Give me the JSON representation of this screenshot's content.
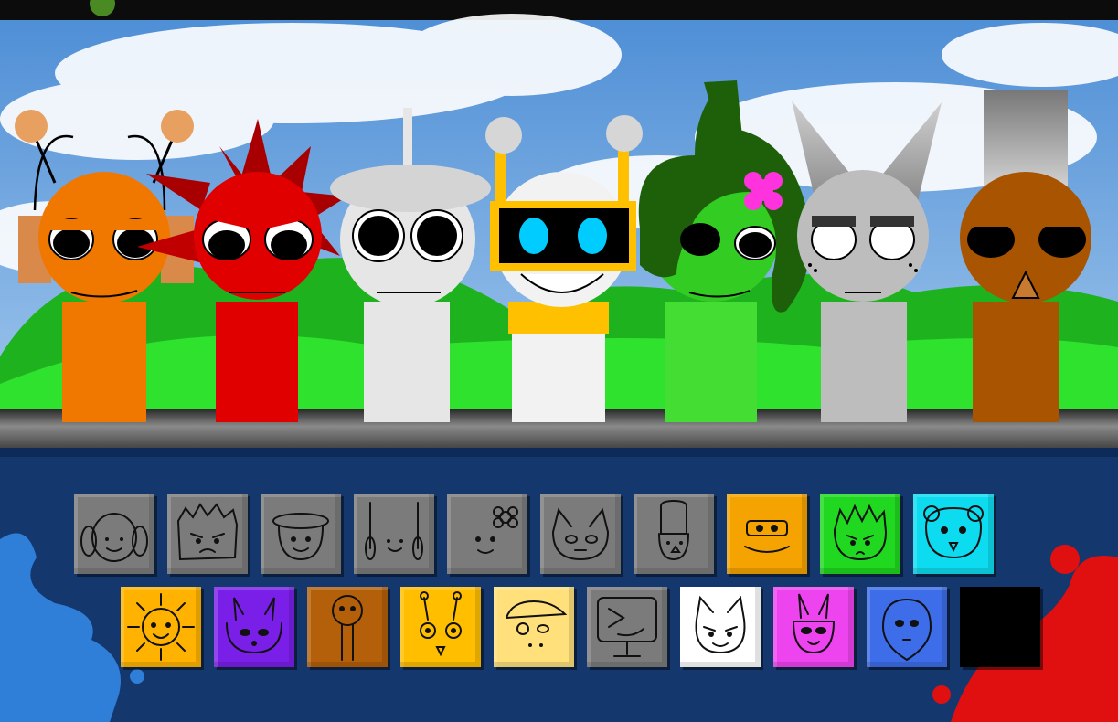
{
  "game": {
    "colors": {
      "sky": "#6fa5dc",
      "hills": "#22c422",
      "panel": "#14376d",
      "rail": "#5a5a5a"
    },
    "stage_characters": [
      {
        "id": "orange-headphones",
        "head": "#f07800",
        "body": "#f07800",
        "accessory": "antenna-headphones"
      },
      {
        "id": "red-spiky",
        "head": "#e00000",
        "body": "#e00000",
        "accessory": "spikes"
      },
      {
        "id": "white-hat",
        "head": "#e6e6e6",
        "body": "#e6e6e6",
        "accessory": "flat-hat"
      },
      {
        "id": "white-robot",
        "head": "#f2f2f2",
        "body": "#f2f2f2",
        "accessory": "visor-antennas"
      },
      {
        "id": "green-hair",
        "head": "#33cc22",
        "body": "#44dd33",
        "accessory": "hair-flower"
      },
      {
        "id": "gray-cat",
        "head": "#bdbdbd",
        "body": "#bdbdbd",
        "accessory": "cat-ears"
      },
      {
        "id": "brown-tophat",
        "head": "#a85400",
        "body": "#a85400",
        "accessory": "top-hat"
      }
    ],
    "palette_row1": [
      {
        "id": "headphones",
        "color": "#7b7b7b",
        "icon": "headphones-face-icon"
      },
      {
        "id": "spiky",
        "color": "#7b7b7b",
        "icon": "spiky-angry-face-icon"
      },
      {
        "id": "flat-hat",
        "color": "#7b7b7b",
        "icon": "flat-hat-face-icon"
      },
      {
        "id": "antenna-sticks",
        "color": "#7b7b7b",
        "icon": "antenna-sticks-face-icon"
      },
      {
        "id": "flower",
        "color": "#7b7b7b",
        "icon": "flower-face-icon"
      },
      {
        "id": "cat",
        "color": "#7b7b7b",
        "icon": "cat-ears-face-icon"
      },
      {
        "id": "tall-hat",
        "color": "#7b7b7b",
        "icon": "tall-hat-face-icon"
      },
      {
        "id": "robot-visor",
        "color": "#f5a300",
        "icon": "robot-visor-face-icon"
      },
      {
        "id": "green-spiky",
        "color": "#1fd81f",
        "icon": "green-spiky-face-icon"
      },
      {
        "id": "bear",
        "color": "#0ddcf0",
        "icon": "bear-ears-face-icon"
      }
    ],
    "palette_row2": [
      {
        "id": "sun",
        "color": "#ffb300",
        "icon": "sun-face-icon"
      },
      {
        "id": "bunny",
        "color": "#7a1fe8",
        "icon": "bunny-face-icon"
      },
      {
        "id": "stick",
        "color": "#b4600a",
        "icon": "stick-head-icon"
      },
      {
        "id": "bug",
        "color": "#ffbf00",
        "icon": "bug-antenna-face-icon"
      },
      {
        "id": "cap",
        "color": "#ffe07a",
        "icon": "cap-face-icon"
      },
      {
        "id": "monitor",
        "color": "#7b7b7b",
        "icon": "monitor-face-icon"
      },
      {
        "id": "white-cat",
        "color": "#ffffff",
        "icon": "white-cat-face-icon"
      },
      {
        "id": "pink-bunny",
        "color": "#ee44f0",
        "icon": "pink-bunny-face-icon"
      },
      {
        "id": "blue-drop",
        "color": "#3d6de8",
        "icon": "blue-drop-face-icon"
      },
      {
        "id": "empty",
        "color": "#000000",
        "icon": "empty-slot"
      }
    ]
  }
}
